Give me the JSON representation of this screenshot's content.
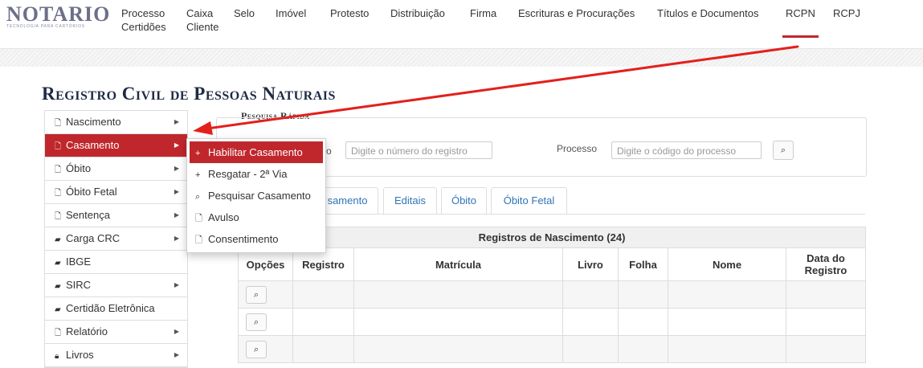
{
  "logo": {
    "main": "NOTARIO",
    "sub": "TECNOLOGIA PARA CARTÓRIOS"
  },
  "nav": {
    "items": [
      {
        "line1": "Processo",
        "line2": "Certidões"
      },
      {
        "line1": "Caixa",
        "line2": "Cliente"
      },
      {
        "line1": "Selo",
        "line2": ""
      },
      {
        "line1": "Imóvel",
        "line2": ""
      },
      {
        "line1": "Protesto",
        "line2": ""
      },
      {
        "line1": "Distribuição",
        "line2": ""
      },
      {
        "line1": "Firma",
        "line2": ""
      },
      {
        "line1": "Escrituras e Procurações",
        "line2": ""
      },
      {
        "line1": "Títulos e Documentos",
        "line2": ""
      },
      {
        "line1": "RCPN",
        "line2": "",
        "active": true
      },
      {
        "line1": "RCPJ",
        "line2": ""
      }
    ]
  },
  "page": {
    "title": "Registro Civil de Pessoas Naturais"
  },
  "sidebar": {
    "items": [
      {
        "label": "Nascimento",
        "icon": "file-icon"
      },
      {
        "label": "Casamento",
        "icon": "file-icon",
        "active": true
      },
      {
        "label": "Óbito",
        "icon": "file-icon"
      },
      {
        "label": "Óbito Fetal",
        "icon": "file-icon"
      },
      {
        "label": "Sentença",
        "icon": "file-icon"
      },
      {
        "label": "Carga CRC",
        "icon": "folder-icon"
      },
      {
        "label": "IBGE",
        "icon": "folder-icon"
      },
      {
        "label": "SIRC",
        "icon": "folder-icon"
      },
      {
        "label": "Certidão Eletrônica",
        "icon": "folder-icon"
      },
      {
        "label": "Relatório",
        "icon": "file-icon"
      },
      {
        "label": "Livros",
        "icon": "lock-icon"
      }
    ]
  },
  "dropdown": {
    "items": [
      {
        "label": "Habilitar Casamento",
        "icon": "plus-icon",
        "active": true
      },
      {
        "label": "Resgatar - 2ª Via",
        "icon": "plus-icon"
      },
      {
        "label": "Pesquisar Casamento",
        "icon": "search-icon"
      },
      {
        "label": "Avulso",
        "icon": "file-icon"
      },
      {
        "label": "Consentimento",
        "icon": "file-icon"
      }
    ]
  },
  "quick_search": {
    "title": "Pesquisa Rápida",
    "registro_label_partial": "o",
    "registro_placeholder": "Digite o número do registro",
    "processo_label": "Processo",
    "processo_placeholder": "Digite o código do processo"
  },
  "tabs": [
    {
      "label": "samento"
    },
    {
      "label": "Editais"
    },
    {
      "label": "Óbito"
    },
    {
      "label": "Óbito Fetal"
    }
  ],
  "table": {
    "caption": "Registros de Nascimento (24)",
    "headers": [
      "Opções",
      "Registro",
      "Matrícula",
      "Livro",
      "Folha",
      "Nome",
      "Data do Registro"
    ],
    "rows": [
      [
        "",
        "",
        "",
        "",
        "",
        "",
        ""
      ],
      [
        "",
        "",
        "",
        "",
        "",
        "",
        ""
      ],
      [
        "",
        "",
        "",
        "",
        "",
        "",
        ""
      ]
    ]
  },
  "colors": {
    "accent": "#c0272d",
    "link": "#2f75b5",
    "title": "#1f2a44",
    "logo": "#6d6f8a"
  }
}
